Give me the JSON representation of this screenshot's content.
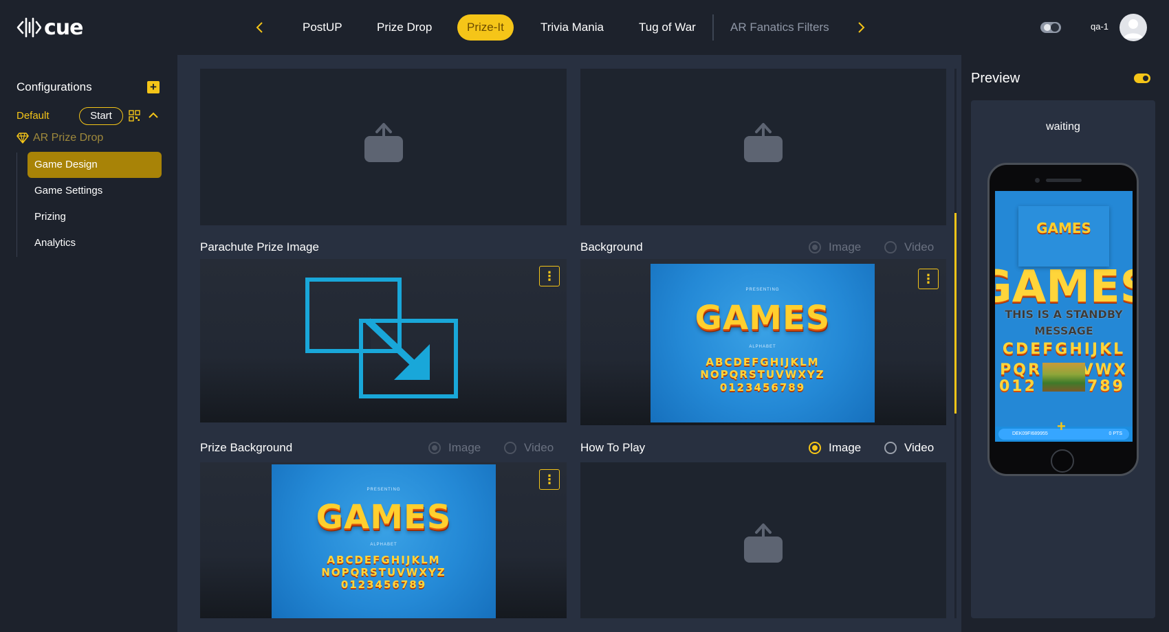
{
  "app": {
    "logo_text": "cue"
  },
  "nav": {
    "tabs": [
      {
        "label": "PostUP"
      },
      {
        "label": "Prize Drop"
      },
      {
        "label": "Prize-It"
      },
      {
        "label": "Trivia Mania"
      },
      {
        "label": "Tug of War"
      },
      {
        "label": "AR Fanatics Filters"
      }
    ],
    "active_tab": "Prize-It"
  },
  "user": {
    "name": "qa-1"
  },
  "sidebar": {
    "title": "Configurations",
    "add_label": "+",
    "config_name": "Default",
    "start_label": "Start",
    "experience": "AR Prize Drop",
    "menu": [
      {
        "label": "Game Design",
        "active": true
      },
      {
        "label": "Game Settings"
      },
      {
        "label": "Prizing"
      },
      {
        "label": "Analytics"
      }
    ]
  },
  "content": {
    "fields": {
      "parachute": {
        "label": "Parachute Prize Image"
      },
      "background": {
        "label": "Background",
        "image_label": "Image",
        "video_label": "Video",
        "selected": "Image",
        "disabled": true
      },
      "prize_background": {
        "label": "Prize Background",
        "image_label": "Image",
        "video_label": "Video",
        "selected": "Image",
        "disabled": true
      },
      "how_to_play": {
        "label": "How To Play",
        "image_label": "Image",
        "video_label": "Video",
        "selected": "Image",
        "disabled": false
      }
    },
    "games_image": {
      "presenting": "PRESENTING",
      "title": "GAMES",
      "alphabet_label": "ALPHABET",
      "row1": "ABCDEFGHIJKLM",
      "row2": "NOPQRSTUVWXYZ",
      "row3": "0123456789"
    },
    "menu_glyph": "⋮"
  },
  "preview": {
    "title": "Preview",
    "status": "waiting",
    "enabled": true,
    "screen": {
      "card_title": "GAMES",
      "big_word": "GAMES",
      "message_line1": "THIS IS A STANDBY",
      "message_line2": "MESSAGE",
      "row_a": "CDEFGHIJKL",
      "row_b": "PQRSTUVWX",
      "row_c": "012",
      "row_c2": "789",
      "footer_id": "DEK09FI689955",
      "footer_pts": "0 PTS",
      "plus": "+"
    }
  },
  "colors": {
    "accent": "#f5c518",
    "background": "#1d222c",
    "panel": "#283040",
    "upload_icon": "#5d6472",
    "swap_icon": "#19a7d9"
  }
}
